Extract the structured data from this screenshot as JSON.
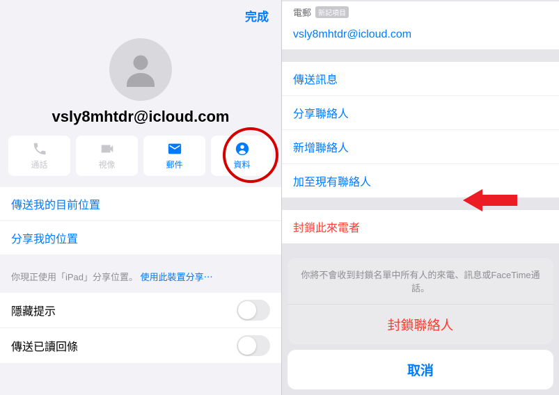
{
  "left": {
    "done": "完成",
    "contact_name": "vsly8mhtdr@icloud.com",
    "actions": {
      "call": "通話",
      "video": "視像",
      "mail": "郵件",
      "info": "資料"
    },
    "location_group": {
      "send_current": "傳送我的目前位置",
      "share": "分享我的位置"
    },
    "footnote_prefix": "你現正使用「iPad」分享位置。",
    "footnote_link": "使用此裝置分享⋯",
    "toggles": {
      "hide_alerts": "隱藏提示",
      "send_read": "傳送已讀回條"
    }
  },
  "right": {
    "email_label": "電郵",
    "email_badge": "新記項目",
    "email_value": "vsly8mhtdr@icloud.com",
    "menu": {
      "send_message": "傳送訊息",
      "share_contact": "分享聯絡人",
      "new_contact": "新增聯絡人",
      "add_existing": "加至現有聯絡人"
    },
    "block_caller": "封鎖此來電者",
    "sheet": {
      "message": "你將不會收到封鎖名單中所有人的來電、訊息或FaceTime通話。",
      "confirm": "封鎖聯絡人",
      "cancel": "取消"
    }
  }
}
